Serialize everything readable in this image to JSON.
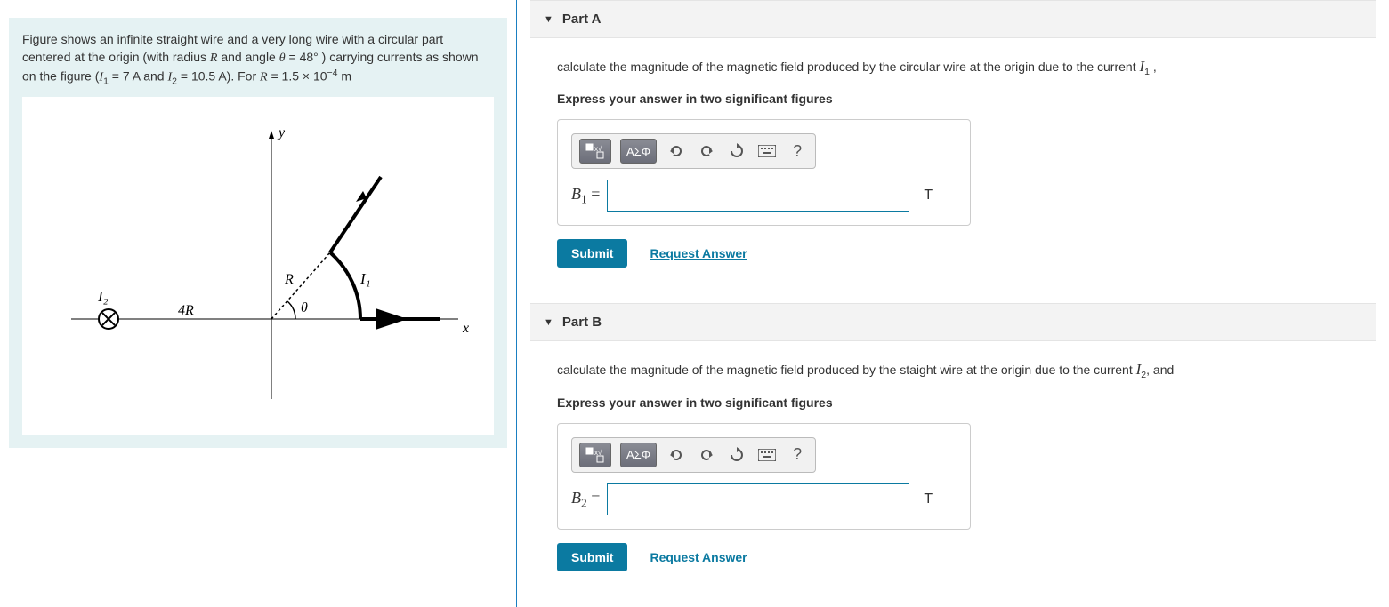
{
  "problem": {
    "text_pre": "Figure shows an infinite straight wire and a very long wire with a circular part centered at the origin  (with radius ",
    "R": "R",
    "text_angle_pre": " and angle ",
    "theta": "θ",
    "eq": " = ",
    "angle_val": "48°",
    "text_mid": " ) carrying currents as shown on the figure (",
    "I1": "I",
    "I1sub": "1",
    "I1val": " = 7 A",
    "and": "  and ",
    "I2": "I",
    "I2sub": "2",
    "I2val": " = 10.5 A",
    "text_for": "). For ",
    "Rlbl": "R",
    "Rval": " = 1.5 × 10",
    "Rexp": "−4",
    "Runit": " m"
  },
  "figure": {
    "y_label": "y",
    "x_label": "x",
    "R_label": "R",
    "theta_label": "θ",
    "I1_label": "I₁",
    "I2_label": "I₂",
    "dist_label": "4R"
  },
  "partA": {
    "title": "Part A",
    "question_pre": "calculate the magnitude of the magnetic field produced by the circular wire at the origin due to the current ",
    "var": "I",
    "sub": "1",
    "question_post": " ,",
    "instruction": "Express your answer in two significant figures",
    "var_label": "B",
    "var_sub": "1",
    "eq": " =",
    "unit": "T",
    "submit": "Submit",
    "request": "Request Answer"
  },
  "partB": {
    "title": "Part B",
    "question_pre": "calculate the magnitude of the magnetic field produced by the staight wire at the origin due to the current ",
    "var": "I",
    "sub": "2",
    "question_post": ", and",
    "instruction": "Express your answer in two significant figures",
    "var_label": "B",
    "var_sub": "2",
    "eq": " =",
    "unit": "T",
    "submit": "Submit",
    "request": "Request Answer"
  },
  "toolbar": {
    "greek": "ΑΣΦ",
    "help": "?"
  }
}
